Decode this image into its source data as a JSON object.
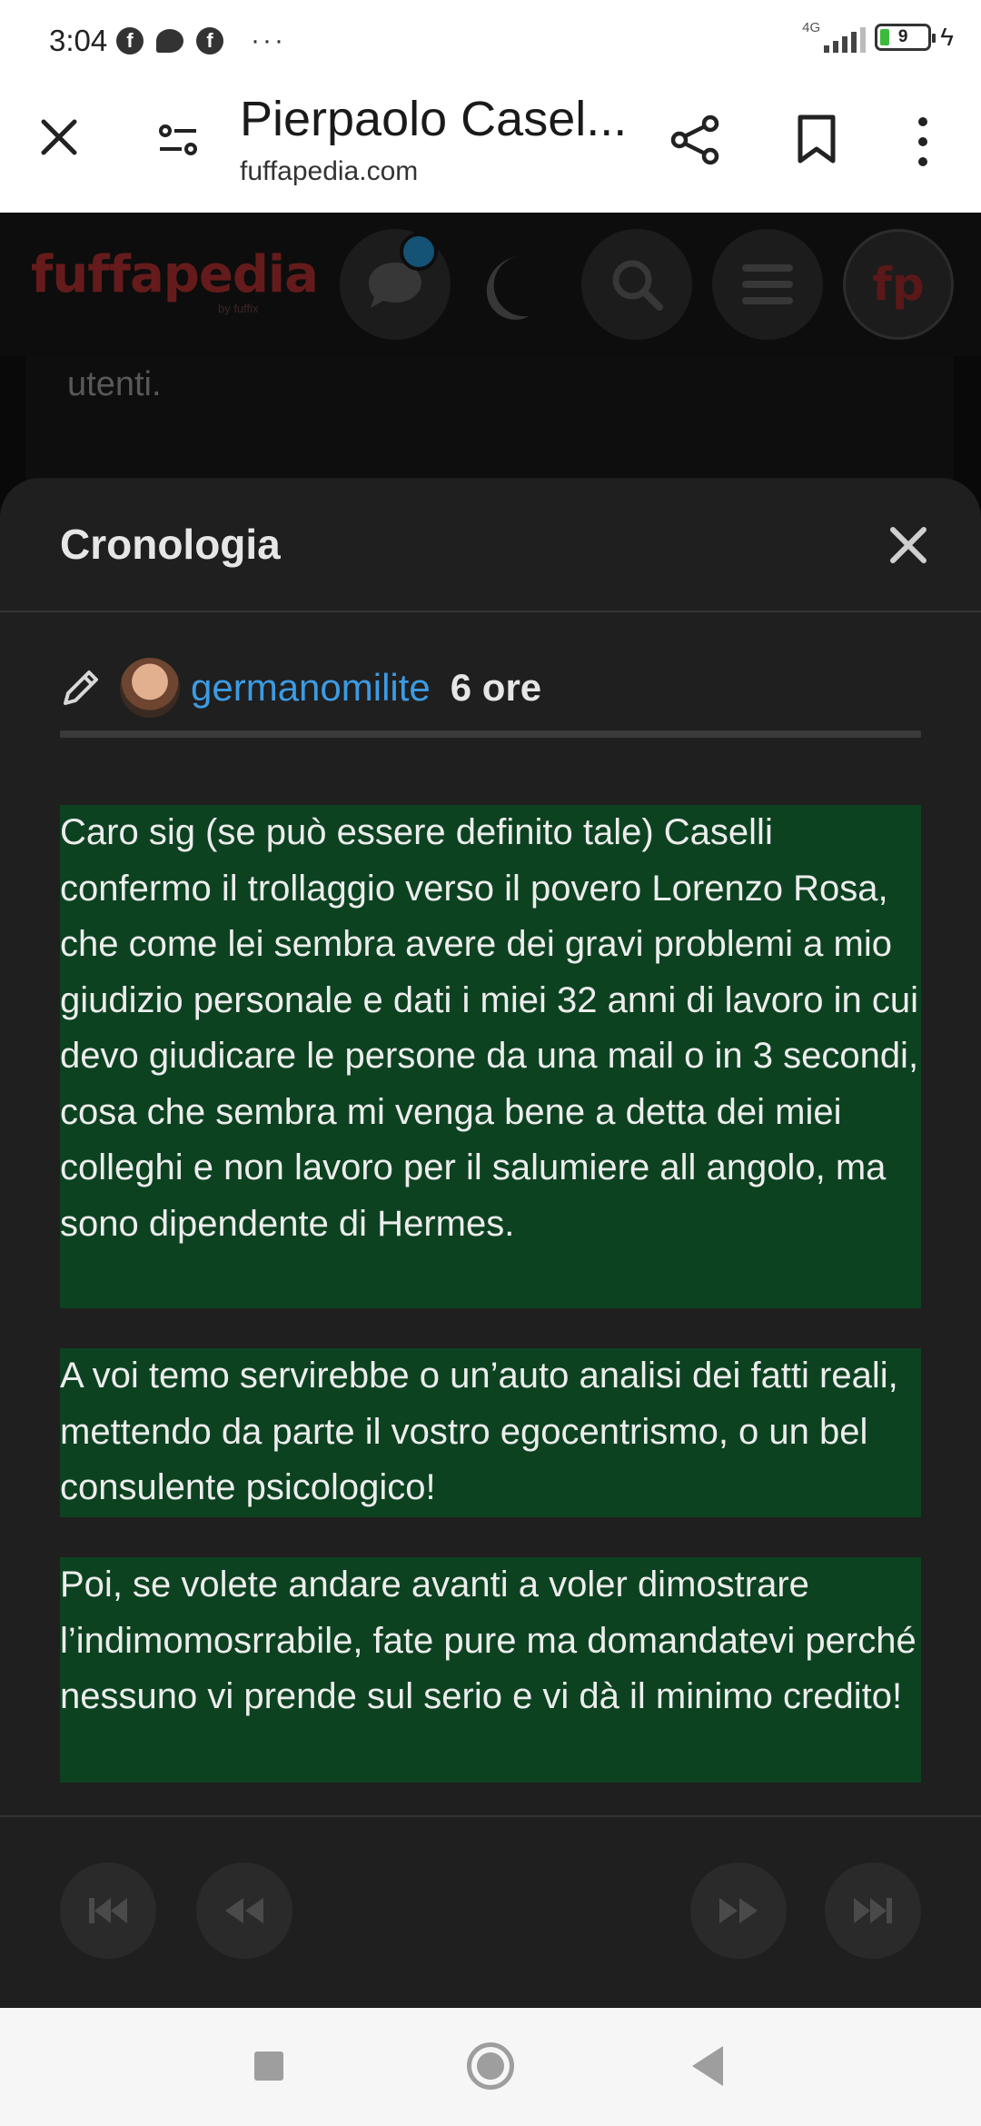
{
  "status_bar": {
    "time": "3:04",
    "network": "4G",
    "battery": "9",
    "more": "···"
  },
  "browser": {
    "page_title": "Pierpaolo Casel...",
    "url": "fuffapedia.com"
  },
  "site": {
    "logo": "fuffapedia",
    "logo_sub": "by fuffix",
    "avatar_initials": "fp"
  },
  "background_page": {
    "text": "utenti."
  },
  "history_sheet": {
    "title": "Cronologia",
    "author": "germanomilite",
    "time_ago": "6 ore",
    "paragraphs": [
      "Caro sig (se può essere definito tale) Caselli confermo il trollaggio verso il povero Lorenzo Rosa, che come lei sembra avere dei gravi problemi a mio giudizio personale e dati i miei 32 anni di lavoro in cui devo giudicare le persone da una mail o in 3 secondi, cosa che sembra mi venga bene a detta dei miei colleghi e non lavoro per il salumiere all angolo, ma sono dipendente di Hermes.",
      "A voi temo servirebbe o un’auto analisi dei fatti reali, mettendo da parte il vostro egocentrismo, o un bel consulente psicologico!",
      "Poi, se volete andare avanti a voler dimostrare l’indimomosrrabile, fate pure ma domandatevi perché nessuno vi prende sul serio e vi dà il minimo credito!"
    ],
    "highlight_color": "#0d4221",
    "username_color": "#3c9be3"
  },
  "icons": {
    "toolbar": [
      "close-icon",
      "page-settings-icon",
      "share-icon",
      "bookmark-icon",
      "more-vert-icon"
    ],
    "header": [
      "chat-icon",
      "moon-icon",
      "search-icon",
      "menu-icon",
      "avatar"
    ],
    "footer": [
      "first-page-icon",
      "previous-icon",
      "next-icon",
      "last-page-icon"
    ]
  }
}
